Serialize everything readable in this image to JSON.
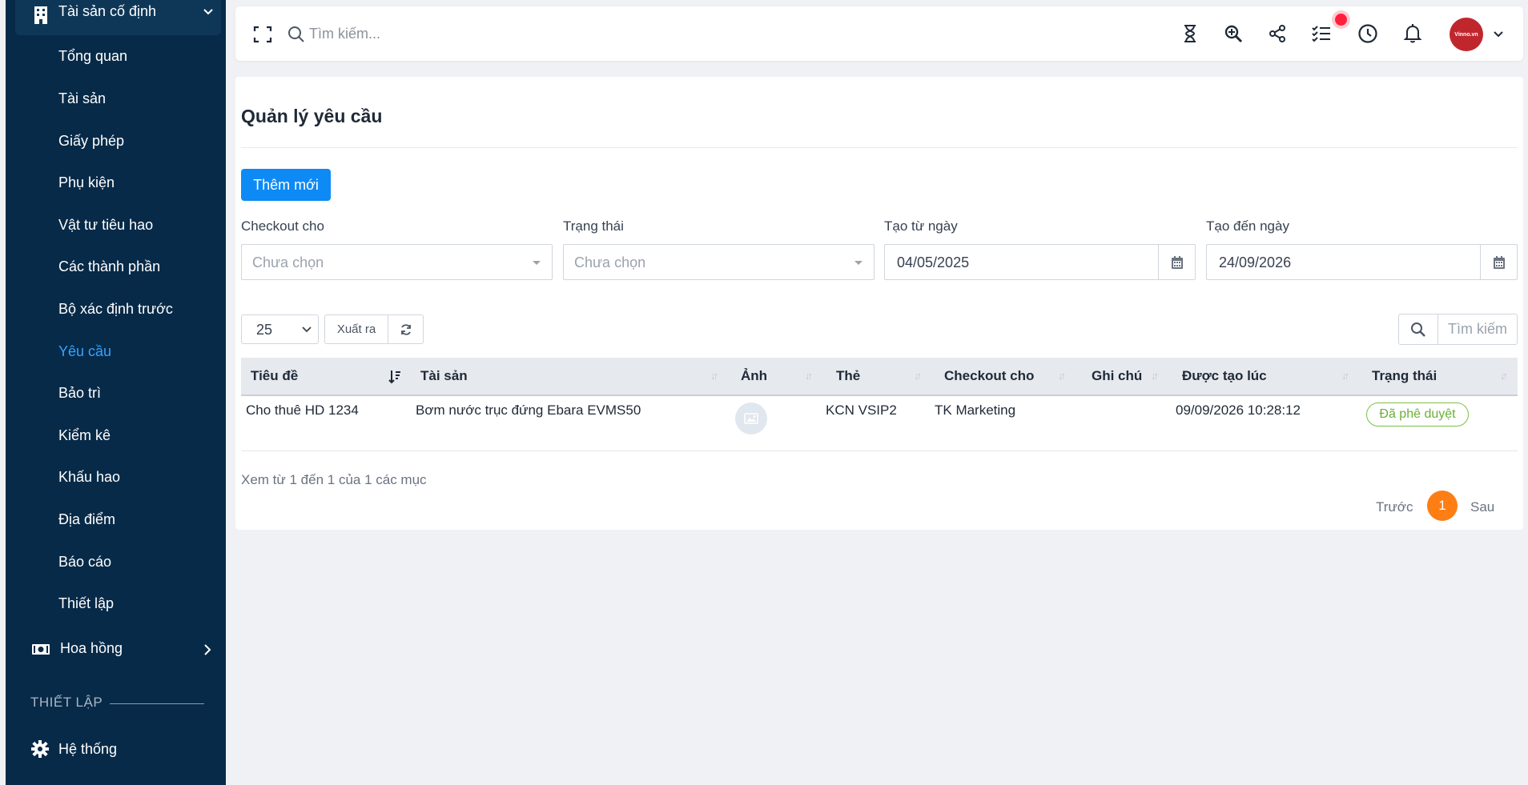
{
  "sidebar": {
    "group_label": "Tài sản cố định",
    "items": [
      {
        "label": "Tổng quan"
      },
      {
        "label": "Tài sản"
      },
      {
        "label": "Giấy phép"
      },
      {
        "label": "Phụ kiện"
      },
      {
        "label": "Vật tư tiêu hao"
      },
      {
        "label": "Các thành phần"
      },
      {
        "label": "Bộ xác định trước"
      },
      {
        "label": "Yêu cầu",
        "active": true
      },
      {
        "label": "Bảo trì"
      },
      {
        "label": "Kiểm kê"
      },
      {
        "label": "Khấu hao"
      },
      {
        "label": "Địa điểm"
      },
      {
        "label": "Báo cáo"
      },
      {
        "label": "Thiết lập"
      }
    ],
    "commission_label": "Hoa hồng",
    "section_label": "THIẾT LẬP",
    "system_label": "Hệ thống"
  },
  "topbar": {
    "search_placeholder": "Tìm kiếm...",
    "avatar_brand": "Vinno.vn"
  },
  "page": {
    "title": "Quản lý yêu cầu",
    "add_button": "Thêm mới"
  },
  "filters": {
    "checkout_label": "Checkout cho",
    "checkout_placeholder": "Chưa chọn",
    "status_label": "Trạng thái",
    "status_placeholder": "Chưa chọn",
    "from_label": "Tạo từ ngày",
    "from_value": "04/05/2025",
    "to_label": "Tạo đến ngày",
    "to_value": "24/09/2026"
  },
  "toolbar": {
    "page_size": "25",
    "export_label": "Xuất ra",
    "search_placeholder": "Tìm kiếm"
  },
  "table": {
    "columns": [
      "Tiêu đề",
      "Tài sản",
      "Ảnh",
      "Thẻ",
      "Checkout cho",
      "Ghi chú",
      "Được tạo lúc",
      "Trạng thái"
    ],
    "rows": [
      {
        "title": "Cho thuê HD 1234",
        "asset": "Bơm nước trục đứng Ebara EVMS50",
        "tag": "KCN VSIP2",
        "checkout": "TK Marketing",
        "note": "",
        "created_at": "09/09/2026 10:28:12",
        "status": "Đã phê duyệt"
      }
    ]
  },
  "footer": {
    "info": "Xem từ 1 đến 1 của 1 các mục",
    "prev": "Trước",
    "current_page": "1",
    "next": "Sau"
  },
  "colors": {
    "sidebar_bg": "#072a48",
    "accent": "#0d8af5",
    "active_item": "#36a3ff",
    "approved": "#69b034",
    "page_active": "#fd7e14"
  }
}
